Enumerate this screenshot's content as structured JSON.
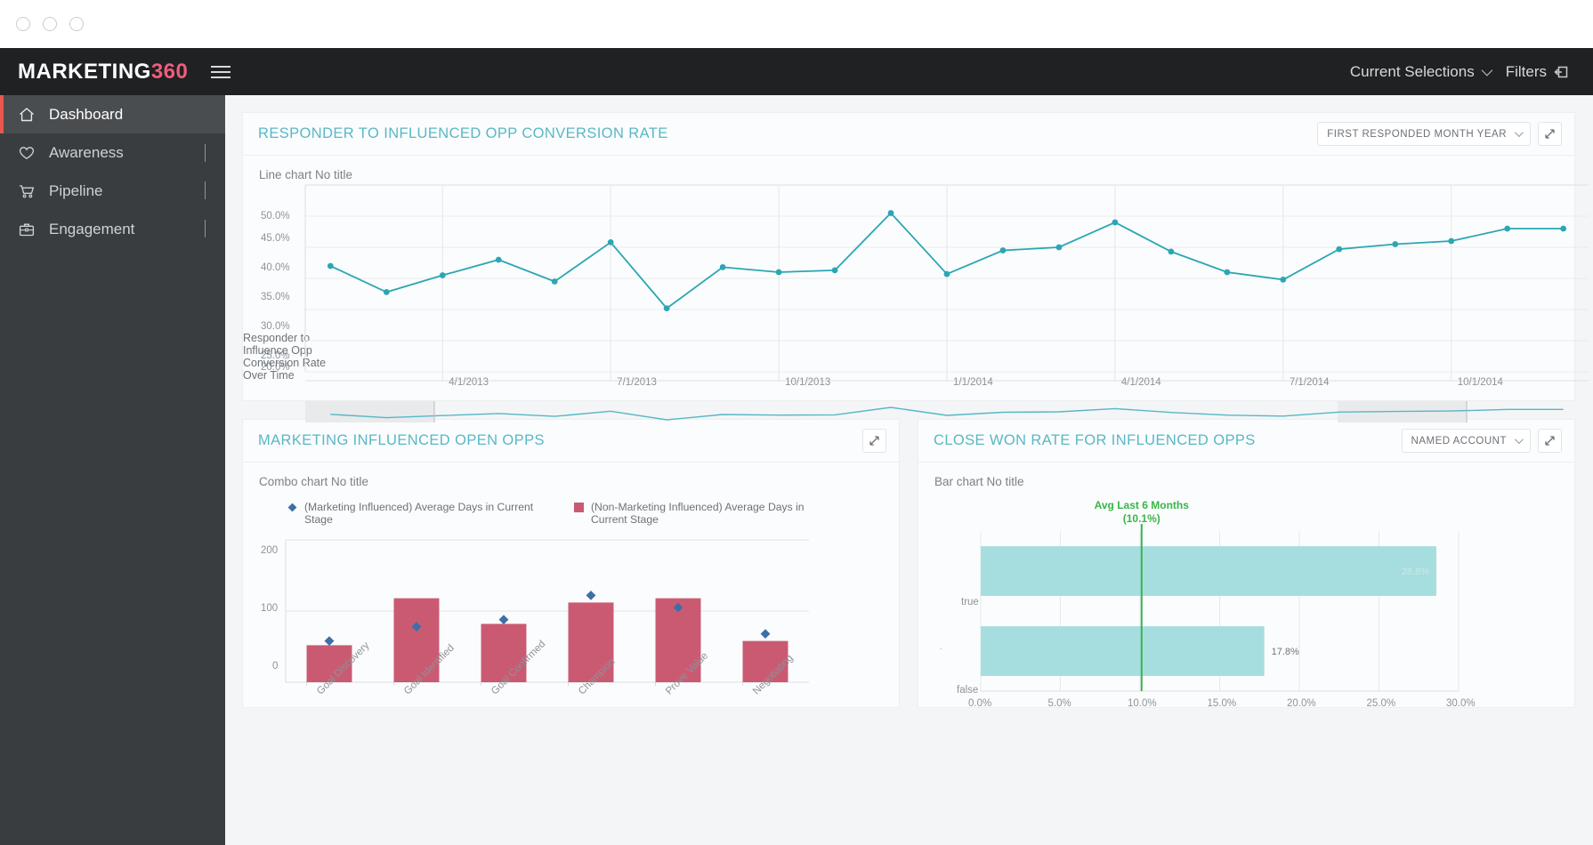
{
  "window": {
    "dots": [
      "minimize-dot",
      "maximize-dot",
      "close-dot"
    ]
  },
  "topnav": {
    "brand_main": "MARKETING",
    "brand_num": "360",
    "menu_icon": "hamburger-icon",
    "current_selections": "Current Selections",
    "filters": "Filters"
  },
  "sidebar": {
    "items": [
      {
        "label": "Dashboard",
        "icon": "home-icon",
        "active": true,
        "arrow": "none"
      },
      {
        "label": "Awareness",
        "icon": "heart-icon",
        "active": false,
        "arrow": "chevron-down"
      },
      {
        "label": "Pipeline",
        "icon": "cart-icon",
        "active": false,
        "arrow": "chevron-right"
      },
      {
        "label": "Engagement",
        "icon": "briefcase-icon",
        "active": false,
        "arrow": "chevron-right"
      }
    ]
  },
  "panels": {
    "line": {
      "title": "RESPONDER TO INFLUENCED OPP CONVERSION RATE",
      "dimension": "FIRST RESPONDED MONTH YEAR",
      "sub_label": "Line chart No title",
      "axis_title": "Responder to Influence Opp Conversion Rate Over Time"
    },
    "combo": {
      "title": "MARKETING INFLUENCED OPEN OPPS",
      "sub_label": "Combo chart No title"
    },
    "bar": {
      "title": "CLOSE WON RATE FOR INFLUENCED OPPS",
      "dimension": "NAMED ACCOUNT",
      "sub_label": "Bar chart No title"
    }
  },
  "colors": {
    "accent_teal": "#4eb3c4",
    "line_teal": "#2ba6b4",
    "bar_pink": "#ca5a72",
    "marker_blue": "#3d6fa8",
    "bar_cyan": "#a6ddde",
    "avg_green": "#39b54a",
    "brand_pink": "#ef5c7d",
    "sidebar_bg": "#3a3d40",
    "topnav_bg": "#1f2123"
  },
  "chart_data": [
    {
      "id": "responder-to-influenced-opp-conversion-rate",
      "type": "line",
      "title": "Line chart No title",
      "xlabel": "",
      "ylabel": "Responder to Influence Opp Conversion Rate Over Time",
      "ylim": [
        20,
        50
      ],
      "yticks": [
        "20.0%",
        "25.0%",
        "30.0%",
        "35.0%",
        "40.0%",
        "45.0%",
        "50.0%"
      ],
      "xticks": [
        "4/1/2013",
        "7/1/2013",
        "10/1/2013",
        "1/1/2014",
        "4/1/2014",
        "7/1/2014",
        "10/1/2014"
      ],
      "grid": true,
      "legend": "none",
      "series": [
        {
          "name": "Responder to Influenced Opp Conversion Rate",
          "x": [
            "2/1/2013",
            "3/1/2013",
            "4/1/2013",
            "5/1/2013",
            "6/1/2013",
            "7/1/2013",
            "8/1/2013",
            "9/1/2013",
            "10/1/2013",
            "11/1/2013",
            "12/1/2013",
            "1/1/2014",
            "2/1/2014",
            "3/1/2014",
            "4/1/2014",
            "5/1/2014",
            "6/1/2014",
            "7/1/2014",
            "8/1/2014",
            "9/1/2014",
            "10/1/2014",
            "11/1/2014",
            "12/1/2014"
          ],
          "values": [
            37.0,
            32.8,
            35.5,
            38.0,
            34.5,
            40.8,
            30.2,
            36.8,
            36.0,
            36.3,
            45.5,
            35.7,
            39.5,
            40.0,
            44.0,
            39.3,
            36.0,
            34.8,
            39.7,
            40.5,
            41.0,
            43.0,
            43.0
          ]
        }
      ],
      "brush": {
        "selected_start_pct": 0,
        "selected_end_pct": 10,
        "present": true
      }
    },
    {
      "id": "marketing-influenced-open-opps",
      "type": "bar",
      "subtype": "combo",
      "title": "Combo chart No title",
      "xlabel": "",
      "ylabel": "",
      "ylim": [
        0,
        200
      ],
      "yticks": [
        "0",
        "100",
        "200"
      ],
      "grid": true,
      "legend": "top",
      "categories": [
        "Goal Discovery",
        "Goal Identified",
        "Goal Confirmed",
        "Champion",
        "Prove Value",
        "Negotiating"
      ],
      "series": [
        {
          "name": "(Non-Marketing Influenced) Average Days in Current Stage",
          "kind": "bar",
          "color": "#ca5a72",
          "values": [
            52,
            118,
            82,
            112,
            118,
            58
          ]
        },
        {
          "name": "(Marketing Influenced) Average Days in Current Stage",
          "kind": "marker",
          "color": "#3d6fa8",
          "values": [
            58,
            78,
            88,
            122,
            105,
            68
          ]
        }
      ]
    },
    {
      "id": "close-won-rate-for-influenced-opps",
      "type": "bar",
      "orientation": "horizontal",
      "title": "Bar chart No title",
      "xlabel": "",
      "ylabel": "",
      "xlim": [
        0,
        30
      ],
      "xticks": [
        "0.0%",
        "5.0%",
        "10.0%",
        "15.0%",
        "20.0%",
        "25.0%",
        "30.0%"
      ],
      "grid": true,
      "legend": "none",
      "categories": [
        "true",
        "false"
      ],
      "values": [
        28.6,
        17.8
      ],
      "value_labels": [
        "28.6%",
        "17.8%"
      ],
      "annotations": [
        {
          "label": "Avg Last 6 Months",
          "sub_label": "(10.1%)",
          "value": 10.1,
          "color": "#39b54a"
        }
      ]
    }
  ]
}
